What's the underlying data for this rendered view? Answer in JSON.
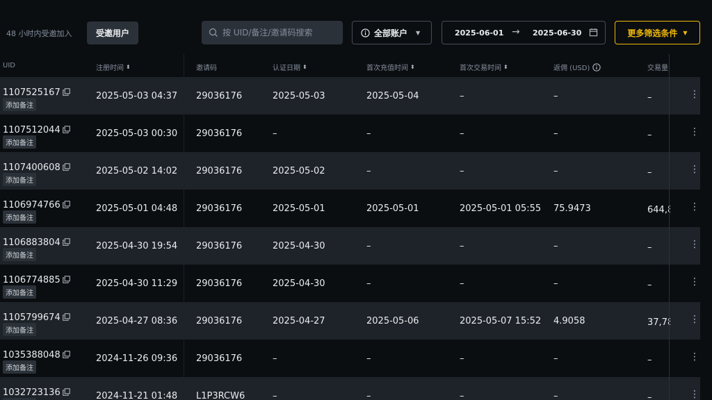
{
  "toolbar": {
    "invite_label": "48 小时内受邀加入",
    "invited_users_button": "受邀用户",
    "search_placeholder": "按 UID/备注/邀请码搜索",
    "account_select": "全部账户",
    "date_from": "2025-06-01",
    "date_to": "2025-06-30",
    "more_filters": "更多筛选条件"
  },
  "columns": {
    "uid": "UID",
    "reg_time": "注册时间",
    "invite_code": "邀请码",
    "verify_date": "认证日期",
    "first_deposit": "首次充值时间",
    "first_trade": "首次交易时间",
    "rebate": "返佣 (USD)",
    "volume": "交易量"
  },
  "add_note_label": "添加备注",
  "rows": [
    {
      "uid": "1107525167",
      "reg_time": "2025-05-03 04:37",
      "invite_code": "29036176",
      "verify_date": "2025-05-03",
      "first_deposit": "2025-05-04",
      "first_trade": "–",
      "rebate": "–",
      "volume": "–"
    },
    {
      "uid": "1107512044",
      "reg_time": "2025-05-03 00:30",
      "invite_code": "29036176",
      "verify_date": "–",
      "first_deposit": "–",
      "first_trade": "–",
      "rebate": "–",
      "volume": "–"
    },
    {
      "uid": "1107400608",
      "reg_time": "2025-05-02 14:02",
      "invite_code": "29036176",
      "verify_date": "2025-05-02",
      "first_deposit": "–",
      "first_trade": "–",
      "rebate": "–",
      "volume": "–"
    },
    {
      "uid": "1106974766",
      "reg_time": "2025-05-01 04:48",
      "invite_code": "29036176",
      "verify_date": "2025-05-01",
      "first_deposit": "2025-05-01",
      "first_trade": "2025-05-01 05:55",
      "rebate": "75.9473",
      "volume": "644,8"
    },
    {
      "uid": "1106883804",
      "reg_time": "2025-04-30 19:54",
      "invite_code": "29036176",
      "verify_date": "2025-04-30",
      "first_deposit": "–",
      "first_trade": "–",
      "rebate": "–",
      "volume": "–"
    },
    {
      "uid": "1106774885",
      "reg_time": "2025-04-30 11:29",
      "invite_code": "29036176",
      "verify_date": "2025-04-30",
      "first_deposit": "–",
      "first_trade": "–",
      "rebate": "–",
      "volume": "–"
    },
    {
      "uid": "1105799674",
      "reg_time": "2025-04-27 08:36",
      "invite_code": "29036176",
      "verify_date": "2025-04-27",
      "first_deposit": "2025-05-06",
      "first_trade": "2025-05-07 15:52",
      "rebate": "4.9058",
      "volume": "37,78"
    },
    {
      "uid": "1035388048",
      "reg_time": "2024-11-26 09:36",
      "invite_code": "29036176",
      "verify_date": "–",
      "first_deposit": "–",
      "first_trade": "–",
      "rebate": "–",
      "volume": "–"
    },
    {
      "uid": "1032723136",
      "reg_time": "2024-11-21 01:48",
      "invite_code": "L1P3RCW6",
      "verify_date": "–",
      "first_deposit": "–",
      "first_trade": "–",
      "rebate": "–",
      "volume": "–"
    }
  ],
  "colors": {
    "accent": "#f0b90b",
    "bg": "#0b0e11",
    "row_alt": "#1e2329"
  }
}
